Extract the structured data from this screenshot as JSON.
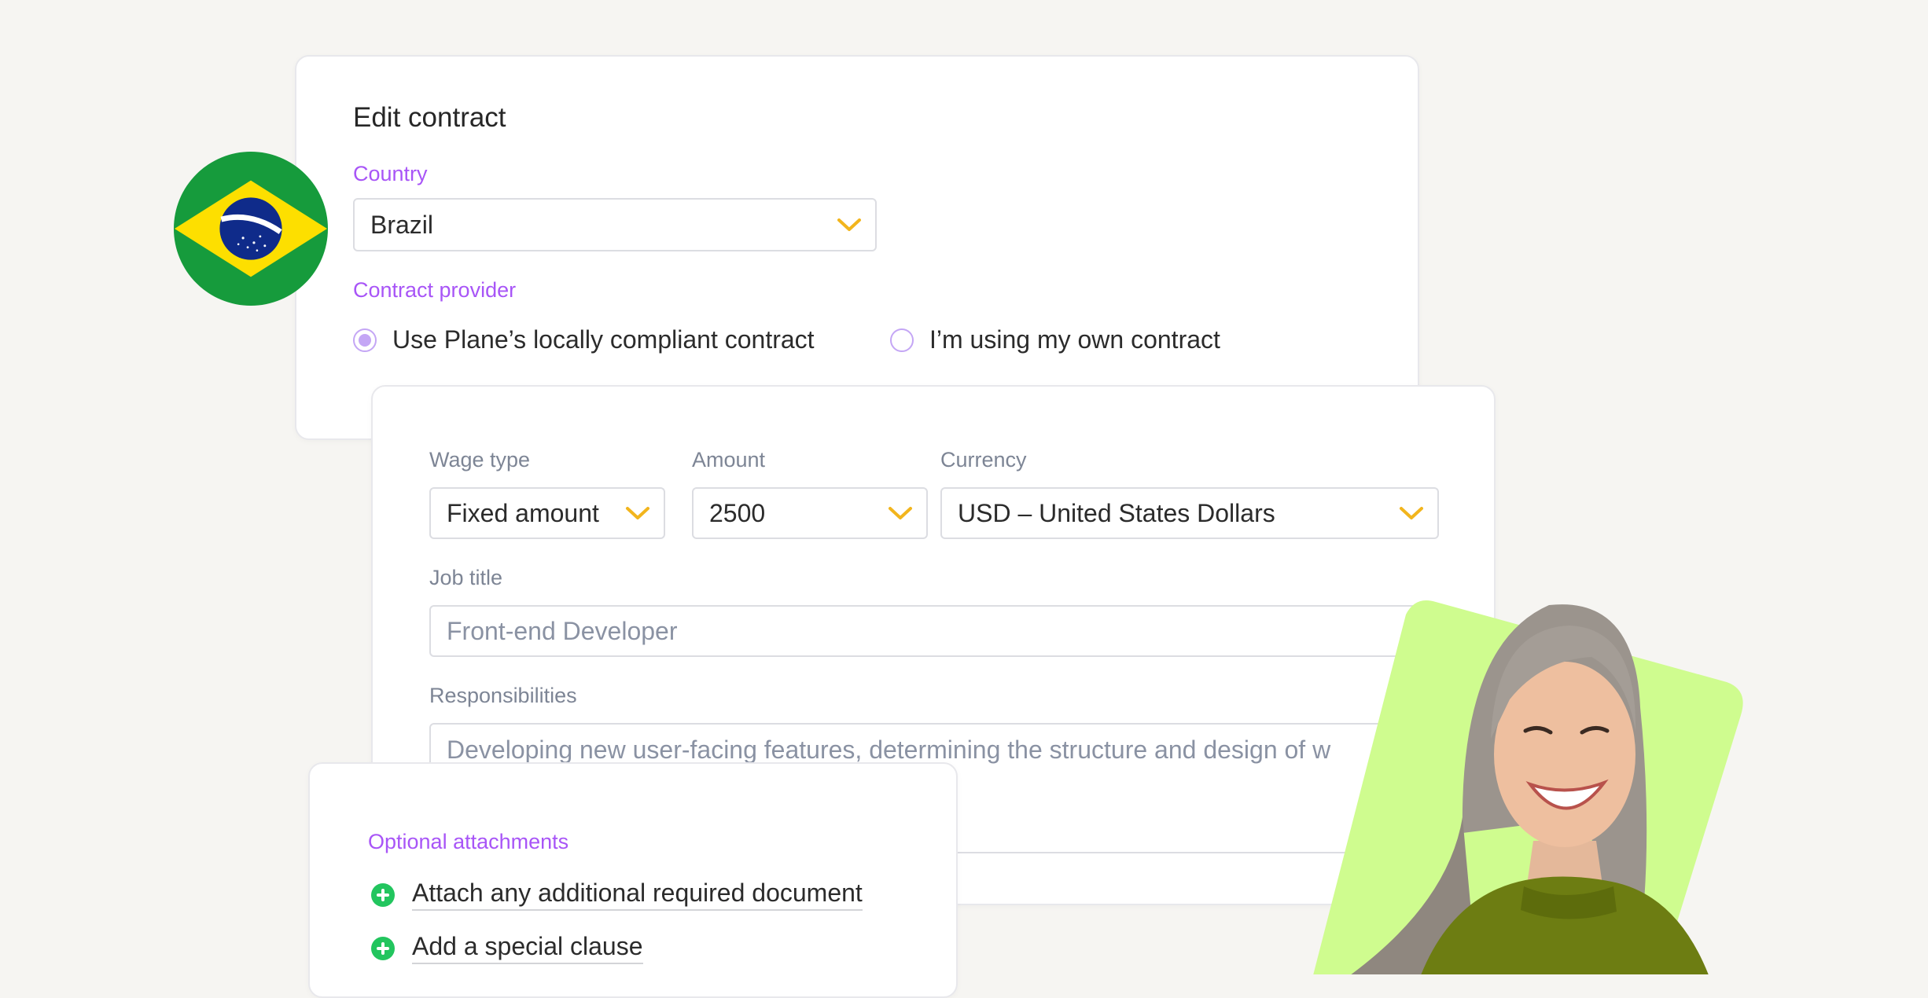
{
  "edit_contract": {
    "title": "Edit contract",
    "country_label": "Country",
    "country_value": "Brazil",
    "provider_label": "Contract provider",
    "provider_options": [
      {
        "label": "Use Plane’s locally compliant contract",
        "checked": true
      },
      {
        "label": "I’m using my own contract",
        "checked": false
      }
    ]
  },
  "wage": {
    "wage_type_label": "Wage type",
    "wage_type_value": "Fixed amount",
    "amount_label": "Amount",
    "amount_value": "2500",
    "currency_label": "Currency",
    "currency_value": "USD – United States Dollars",
    "job_title_label": "Job title",
    "job_title_value": "Front-end Developer",
    "responsibilities_label": "Responsibilities",
    "responsibilities_value": "Developing new user-facing features, determining the structure and design of w"
  },
  "attachments": {
    "label": "Optional attachments",
    "items": [
      "Attach any additional required document",
      "Add a special clause"
    ]
  },
  "colors": {
    "accent_purple": "#a855f7",
    "chevron_yellow": "#f2b51d",
    "plus_green": "#22c55e",
    "portrait_bg": "#cffc8f"
  },
  "icons": {
    "flag": "brazil-flag-icon",
    "chevron": "chevron-down-icon",
    "plus": "plus-circle-icon"
  }
}
